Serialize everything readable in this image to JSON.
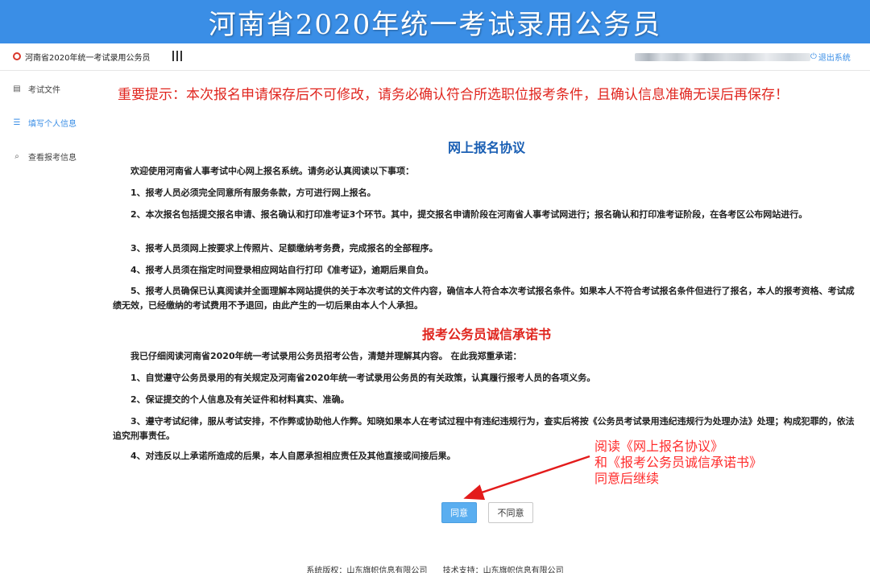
{
  "banner": {
    "title": "河南省2020年统一考试录用公务员"
  },
  "topbar": {
    "app_name": "河南省2020年统一考试录用公务员",
    "logout_label": "退出系统"
  },
  "sidebar": {
    "items": [
      {
        "label": "考试文件",
        "icon": "document-icon"
      },
      {
        "label": "填写个人信息",
        "icon": "form-list-icon",
        "active": true
      },
      {
        "label": "查看报考信息",
        "icon": "search-doc-icon"
      }
    ]
  },
  "main": {
    "notice": "重要提示：本次报名申请保存后不可修改，请务必确认符合所选职位报考条件，且确认信息准确无误后再保存！",
    "agreement_title": "网上报名协议",
    "agreement_paragraphs": [
      "欢迎使用河南省人事考试中心网上报名系统。请务必认真阅读以下事项：",
      "1、报考人员必须完全同意所有服务条款，方可进行网上报名。",
      "2、本次报名包括提交报名申请、报名确认和打印准考证3个环节。其中，提交报名申请阶段在河南省人事考试网进行；报名确认和打印准考证阶段，在各考区公布网站进行。",
      "3、报考人员须网上按要求上传照片、足额缴纳考务费，完成报名的全部程序。",
      "4、报考人员须在指定时间登录相应网站自行打印《准考证》，逾期后果自负。",
      "5、报考人员确保已认真阅读并全面理解本网站提供的关于本次考试的文件内容，确信本人符合本次考试报名条件。如果本人不符合考试报名条件但进行了报名，本人的报考资格、考试成绩无效，已经缴纳的考试费用不予退回，由此产生的一切后果由本人个人承担。"
    ],
    "pledge_title": "报考公务员诚信承诺书",
    "pledge_paragraphs": [
      "我已仔细阅读河南省2020年统一考试录用公务员招考公告，清楚并理解其内容。 在此我郑重承诺：",
      "1、自觉遵守公务员录用的有关规定及河南省2020年统一考试录用公务员的有关政策，认真履行报考人员的各项义务。",
      "2、保证提交的个人信息及有关证件和材料真实、准确。",
      "3、遵守考试纪律，服从考试安排，不作弊或协助他人作弊。知晓如果本人在考试过程中有违纪违规行为，查实后将按《公务员考试录用违纪违规行为处理办法》处理；构成犯罪的，依法追究刑事责任。",
      "4、对违反以上承诺所造成的后果，本人自愿承担相应责任及其他直接或间接后果。"
    ],
    "agree_button": "同意",
    "disagree_button": "不同意"
  },
  "annotation": {
    "lines": [
      "阅读《网上报名协议》",
      "和《报考公务员诚信承诺书》",
      "同意后继续"
    ]
  },
  "footer": {
    "copyright": "系统版权：山东旗帜信息有限公司",
    "support": "技术支持：山东旗帜信息有限公司"
  },
  "colors": {
    "banner": "#3a8ee6",
    "notice": "#e0261f",
    "agreement_title": "#1a5fb4",
    "agree_button": "#5aaef0",
    "annotation": "#ff2c2c"
  }
}
